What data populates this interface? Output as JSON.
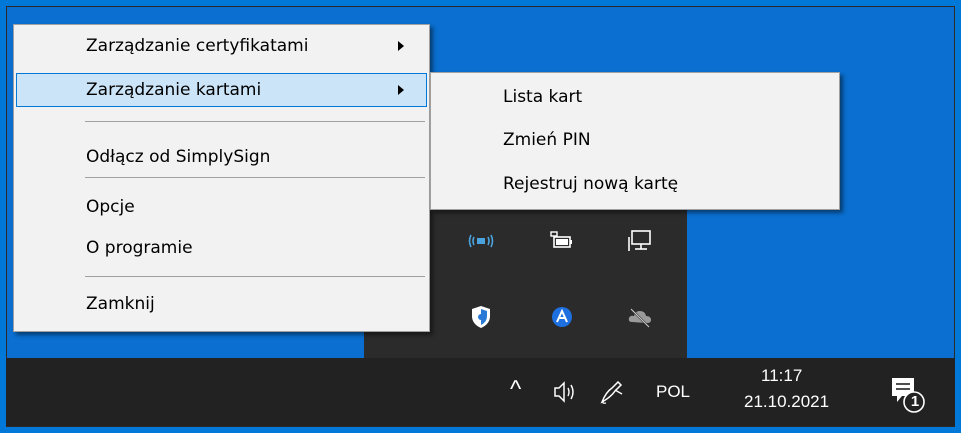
{
  "context_menu": {
    "items": [
      {
        "label": "Zarządzanie certyfikatami",
        "has_submenu": true
      },
      {
        "label": "Zarządzanie kartami",
        "has_submenu": true,
        "highlighted": true
      },
      {
        "label": "Odłącz od SimplySign",
        "has_submenu": false
      },
      {
        "label": "Opcje",
        "has_submenu": false
      },
      {
        "label": "O programie",
        "has_submenu": false
      },
      {
        "label": "Zamknij",
        "has_submenu": false
      }
    ]
  },
  "submenu": {
    "items": [
      {
        "label": "Lista kart"
      },
      {
        "label": "Zmień PIN"
      },
      {
        "label": "Rejestruj nową kartę"
      }
    ]
  },
  "tray_flyout": {
    "icons": [
      "network-adapter-icon",
      "battery-icon",
      "display-icon",
      "security-shield-icon",
      "app-a-icon",
      "onedrive-offline-icon"
    ]
  },
  "taskbar": {
    "chevron": "^",
    "volume_icon": "volume-icon",
    "pen_icon": "pen-icon",
    "language": "POL",
    "time": "11:17",
    "date": "21.10.2021",
    "notification_count": "1"
  },
  "colors": {
    "desktop": "#0078d7",
    "taskbar": "#222222",
    "menu_background": "#f2f2f2",
    "menu_highlight": "#cce4f7",
    "highlight_border": "#0078d7",
    "flyout": "#2b2b2b"
  }
}
